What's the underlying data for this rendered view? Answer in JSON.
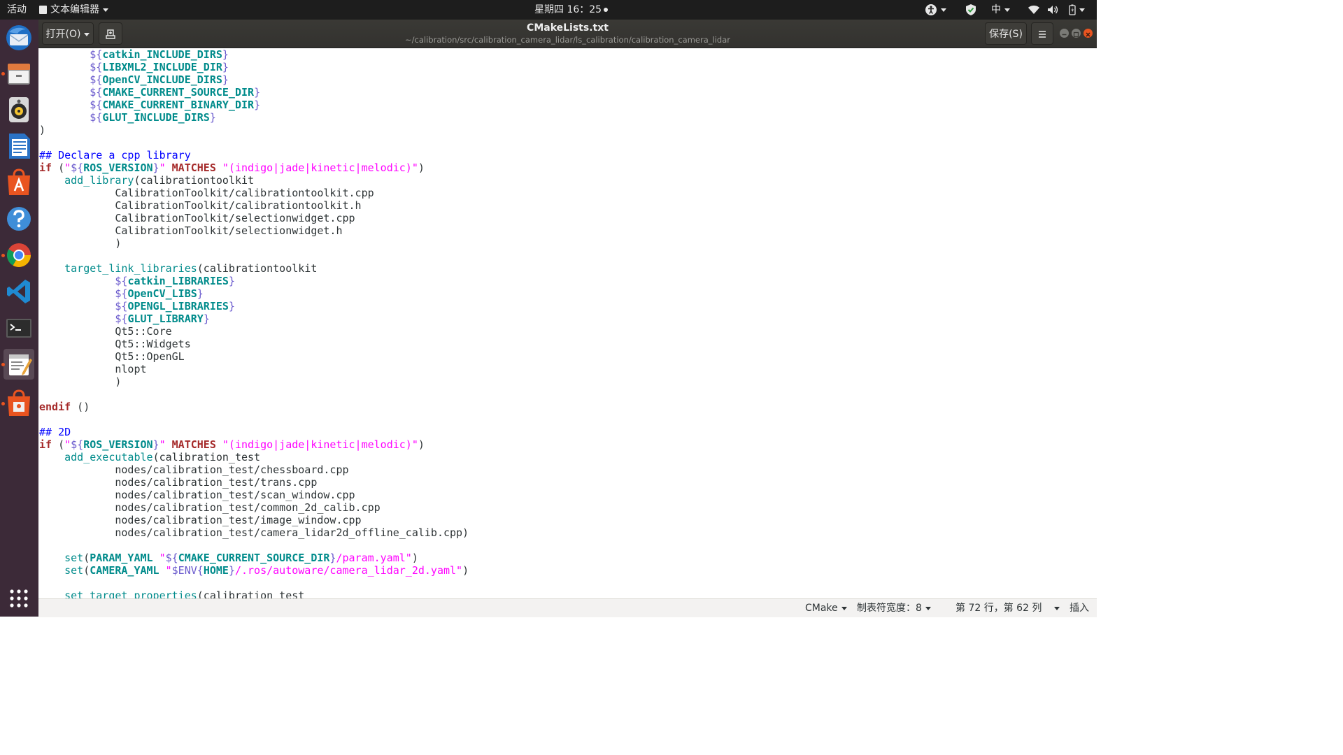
{
  "topbar": {
    "activities": "活动",
    "app_menu": "文本编辑器",
    "clock": "星期四 16：25",
    "input_method": "中"
  },
  "dock": {
    "apps": [
      {
        "name": "thunderbird-icon",
        "running": false
      },
      {
        "name": "files-icon",
        "running": true
      },
      {
        "name": "rhythmbox-icon",
        "running": false
      },
      {
        "name": "libreoffice-writer-icon",
        "running": false
      },
      {
        "name": "ubuntu-software-icon",
        "running": false
      },
      {
        "name": "help-icon",
        "running": false
      },
      {
        "name": "chrome-icon",
        "running": true
      },
      {
        "name": "vscode-icon",
        "running": false
      },
      {
        "name": "terminal-icon",
        "running": false
      },
      {
        "name": "gedit-icon",
        "running": true
      },
      {
        "name": "software-updater-icon",
        "running": true
      }
    ],
    "show_apps": "show-applications-icon"
  },
  "header": {
    "open_label": "打开(O)",
    "title": "CMakeLists.txt",
    "path": "~/calibration/src/calibration_camera_lidar/ls_calibration/calibration_camera_lidar",
    "save_label": "保存(S)"
  },
  "editor": {
    "lines": [
      [
        [
          "p",
          "        "
        ],
        [
          "d",
          "${"
        ],
        [
          "v",
          "catkin_INCLUDE_DIRS"
        ],
        [
          "d",
          "}"
        ]
      ],
      [
        [
          "p",
          "        "
        ],
        [
          "d",
          "${"
        ],
        [
          "v",
          "LIBXML2_INCLUDE_DIR"
        ],
        [
          "d",
          "}"
        ]
      ],
      [
        [
          "p",
          "        "
        ],
        [
          "d",
          "${"
        ],
        [
          "v",
          "OpenCV_INCLUDE_DIRS"
        ],
        [
          "d",
          "}"
        ]
      ],
      [
        [
          "p",
          "        "
        ],
        [
          "d",
          "${"
        ],
        [
          "v",
          "CMAKE_CURRENT_SOURCE_DIR"
        ],
        [
          "d",
          "}"
        ]
      ],
      [
        [
          "p",
          "        "
        ],
        [
          "d",
          "${"
        ],
        [
          "v",
          "CMAKE_CURRENT_BINARY_DIR"
        ],
        [
          "d",
          "}"
        ]
      ],
      [
        [
          "p",
          "        "
        ],
        [
          "d",
          "${"
        ],
        [
          "v",
          "GLUT_INCLUDE_DIRS"
        ],
        [
          "d",
          "}"
        ]
      ],
      [
        [
          "p",
          ")"
        ]
      ],
      [],
      [
        [
          "c",
          "## Declare a cpp library"
        ]
      ],
      [
        [
          "k",
          "if"
        ],
        [
          "p",
          " ("
        ],
        [
          "q",
          "\""
        ],
        [
          "d",
          "${"
        ],
        [
          "v",
          "ROS_VERSION"
        ],
        [
          "d",
          "}"
        ],
        [
          "q",
          "\""
        ],
        [
          "p",
          " "
        ],
        [
          "k",
          "MATCHES"
        ],
        [
          "p",
          " "
        ],
        [
          "s",
          "\"(indigo|jade|kinetic|melodic)\""
        ],
        [
          "p",
          ")"
        ]
      ],
      [
        [
          "p",
          "    "
        ],
        [
          "f",
          "add_library"
        ],
        [
          "p",
          "(calibrationtoolkit"
        ]
      ],
      [
        [
          "p",
          "            CalibrationToolkit/calibrationtoolkit.cpp"
        ]
      ],
      [
        [
          "p",
          "            CalibrationToolkit/calibrationtoolkit.h"
        ]
      ],
      [
        [
          "p",
          "            CalibrationToolkit/selectionwidget.cpp"
        ]
      ],
      [
        [
          "p",
          "            CalibrationToolkit/selectionwidget.h"
        ]
      ],
      [
        [
          "p",
          "            )"
        ]
      ],
      [],
      [
        [
          "p",
          "    "
        ],
        [
          "f",
          "target_link_libraries"
        ],
        [
          "p",
          "(calibrationtoolkit"
        ]
      ],
      [
        [
          "p",
          "            "
        ],
        [
          "d",
          "${"
        ],
        [
          "v",
          "catkin_LIBRARIES"
        ],
        [
          "d",
          "}"
        ]
      ],
      [
        [
          "p",
          "            "
        ],
        [
          "d",
          "${"
        ],
        [
          "v",
          "OpenCV_LIBS"
        ],
        [
          "d",
          "}"
        ]
      ],
      [
        [
          "p",
          "            "
        ],
        [
          "d",
          "${"
        ],
        [
          "v",
          "OPENGL_LIBRARIES"
        ],
        [
          "d",
          "}"
        ]
      ],
      [
        [
          "p",
          "            "
        ],
        [
          "d",
          "${"
        ],
        [
          "v",
          "GLUT_LIBRARY"
        ],
        [
          "d",
          "}"
        ]
      ],
      [
        [
          "p",
          "            Qt5::Core"
        ]
      ],
      [
        [
          "p",
          "            Qt5::Widgets"
        ]
      ],
      [
        [
          "p",
          "            Qt5::OpenGL"
        ]
      ],
      [
        [
          "p",
          "            nlopt"
        ]
      ],
      [
        [
          "p",
          "            )"
        ]
      ],
      [],
      [
        [
          "k",
          "endif"
        ],
        [
          "p",
          " ()"
        ]
      ],
      [],
      [
        [
          "c",
          "## 2D"
        ]
      ],
      [
        [
          "k",
          "if"
        ],
        [
          "p",
          " ("
        ],
        [
          "q",
          "\""
        ],
        [
          "d",
          "${"
        ],
        [
          "v",
          "ROS_VERSION"
        ],
        [
          "d",
          "}"
        ],
        [
          "q",
          "\""
        ],
        [
          "p",
          " "
        ],
        [
          "k",
          "MATCHES"
        ],
        [
          "p",
          " "
        ],
        [
          "s",
          "\"(indigo|jade|kinetic|melodic)\""
        ],
        [
          "p",
          ")"
        ]
      ],
      [
        [
          "p",
          "    "
        ],
        [
          "f",
          "add_executable"
        ],
        [
          "p",
          "(calibration_test"
        ]
      ],
      [
        [
          "p",
          "            nodes/calibration_test/chessboard.cpp"
        ]
      ],
      [
        [
          "p",
          "            nodes/calibration_test/trans.cpp"
        ]
      ],
      [
        [
          "p",
          "            nodes/calibration_test/scan_window.cpp"
        ]
      ],
      [
        [
          "p",
          "            nodes/calibration_test/common_2d_calib.cpp"
        ]
      ],
      [
        [
          "p",
          "            nodes/calibration_test/image_window.cpp"
        ]
      ],
      [
        [
          "p",
          "            nodes/calibration_test/camera_lidar2d_offline_calib.cpp)"
        ]
      ],
      [],
      [
        [
          "p",
          "    "
        ],
        [
          "f",
          "set"
        ],
        [
          "p",
          "("
        ],
        [
          "v",
          "PARAM_YAML"
        ],
        [
          "p",
          " "
        ],
        [
          "q",
          "\""
        ],
        [
          "d",
          "${"
        ],
        [
          "v",
          "CMAKE_CURRENT_SOURCE_DIR"
        ],
        [
          "d",
          "}"
        ],
        [
          "s",
          "/param.yaml\""
        ],
        [
          "p",
          ")"
        ]
      ],
      [
        [
          "p",
          "    "
        ],
        [
          "f",
          "set"
        ],
        [
          "p",
          "("
        ],
        [
          "v",
          "CAMERA_YAML"
        ],
        [
          "p",
          " "
        ],
        [
          "q",
          "\""
        ],
        [
          "d",
          "$ENV{"
        ],
        [
          "v",
          "HOME"
        ],
        [
          "d",
          "}"
        ],
        [
          "s",
          "/.ros/autoware/camera_lidar_2d.yaml\""
        ],
        [
          "p",
          ")"
        ]
      ],
      [],
      [
        [
          "p",
          "    "
        ],
        [
          "f",
          "set_target_properties"
        ],
        [
          "p",
          "(calibration_test"
        ]
      ]
    ]
  },
  "status": {
    "language": "CMake",
    "tab_width": "制表符宽度：8",
    "position": "第 72 行，第 62 列",
    "mode": "插入"
  },
  "colors": {
    "dock_bg": "#3c2a38",
    "topbar_bg": "#1d1d1d",
    "accent": "#e95420"
  }
}
